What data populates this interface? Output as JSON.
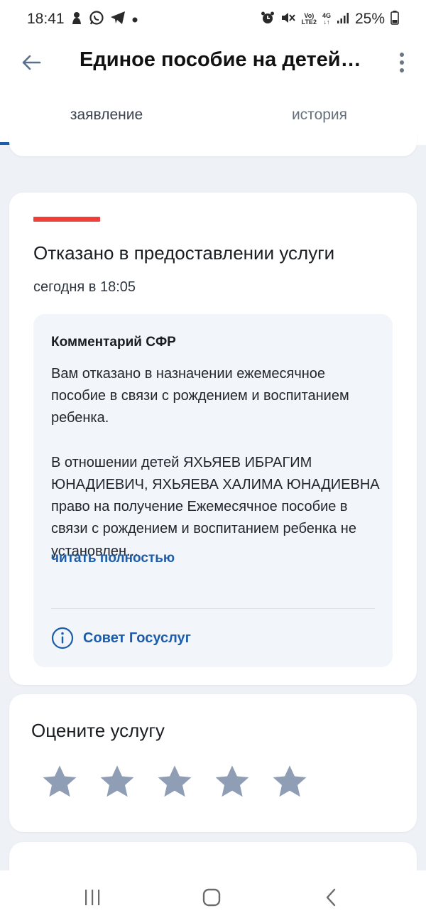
{
  "status_bar": {
    "time": "18:41",
    "battery": "25%",
    "left_icons": [
      "monkey-icon",
      "whatsapp-icon",
      "telegram-icon",
      "dot-icon"
    ],
    "right_icons": [
      "alarm-icon",
      "mute-icon",
      "volte-icon",
      "4g-icon",
      "signal-icon",
      "battery-icon"
    ],
    "volte_top": "Vo)",
    "volte_bottom": "LTE2",
    "net_top": "4G",
    "net_bottom": "↓↑"
  },
  "app_bar": {
    "title": "Единое пособие на детей…"
  },
  "tabs": [
    {
      "label": "заявление",
      "active": true
    },
    {
      "label": "история",
      "active": false
    }
  ],
  "status_card": {
    "accent_color": "#ee3f38",
    "title": "Отказано в предоставлении услуги",
    "time": "сегодня в 18:05",
    "comment": {
      "title": "Комментарий СФР",
      "text": "Вам отказано в назначении ежемесячное пособие в связи с рождением и воспитанием ребенка.\n\nВ отношении детей ЯХЬЯЕВ ИБРАГИМ ЮНАДИЕВИЧ, ЯХЬЯЕВА ХАЛИМА ЮНАДИЕВНА право на получение Ежемесячное пособие в связи с рождением и воспитанием ребенка не установлен...",
      "read_more": "читать полностью",
      "advice": "Совет Госуслуг"
    }
  },
  "rating_card": {
    "title": "Оцените услугу",
    "stars_total": 5,
    "stars_selected": 0,
    "star_color": "#8f9db5"
  },
  "colors": {
    "brand_blue": "#1b5dab",
    "background": "#eef1f6"
  }
}
